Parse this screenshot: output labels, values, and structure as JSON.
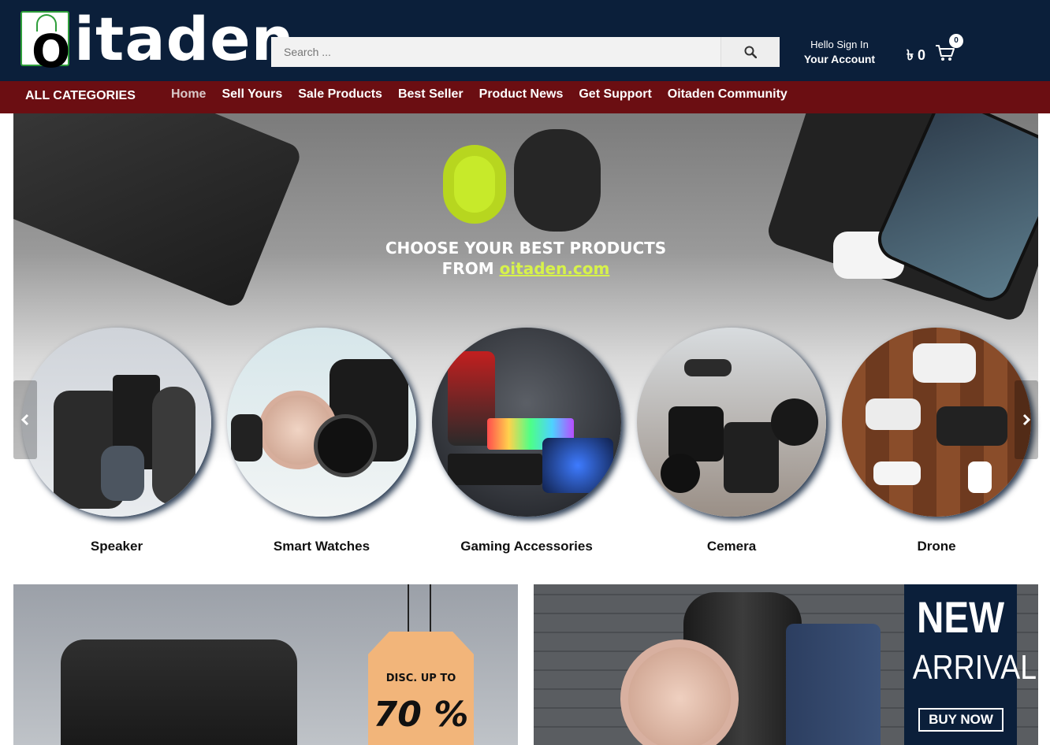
{
  "header": {
    "logo_initial": "O",
    "logo_text": "itaden",
    "search_placeholder": "Search ...",
    "account_hello": "Hello Sign In",
    "account_title": "Your Account",
    "cart_amount": "৳ 0",
    "cart_count": "0"
  },
  "nav": {
    "all_categories": "ALL CATEGORIES",
    "items": [
      {
        "label": "Home"
      },
      {
        "label": "Sell Yours"
      },
      {
        "label": "Sale Products"
      },
      {
        "label": "Best Seller"
      },
      {
        "label": "Product News"
      },
      {
        "label": "Get Support"
      },
      {
        "label": "Oitaden Community"
      }
    ]
  },
  "hero": {
    "line1": "CHOOSE YOUR BEST PRODUCTS",
    "line2_prefix": "FROM ",
    "line2_link": "oitaden.com"
  },
  "categories": [
    {
      "label": "Speaker"
    },
    {
      "label": "Smart Watches"
    },
    {
      "label": "Gaming Accessories"
    },
    {
      "label": "Cemera"
    },
    {
      "label": "Drone"
    }
  ],
  "banners": {
    "left": {
      "tag_line1": "DISC. UP TO",
      "tag_line2": "70 %"
    },
    "right": {
      "title1": "NEW",
      "title2": "ARRIVAL",
      "button": "BUY NOW"
    }
  },
  "colors": {
    "header_bg": "#0b1f3a",
    "nav_bg": "#6b0e12",
    "accent_green": "#d7f24a"
  },
  "icons": {
    "search": "search-icon",
    "cart": "cart-icon",
    "prev": "chevron-left-icon",
    "next": "chevron-right-icon"
  }
}
